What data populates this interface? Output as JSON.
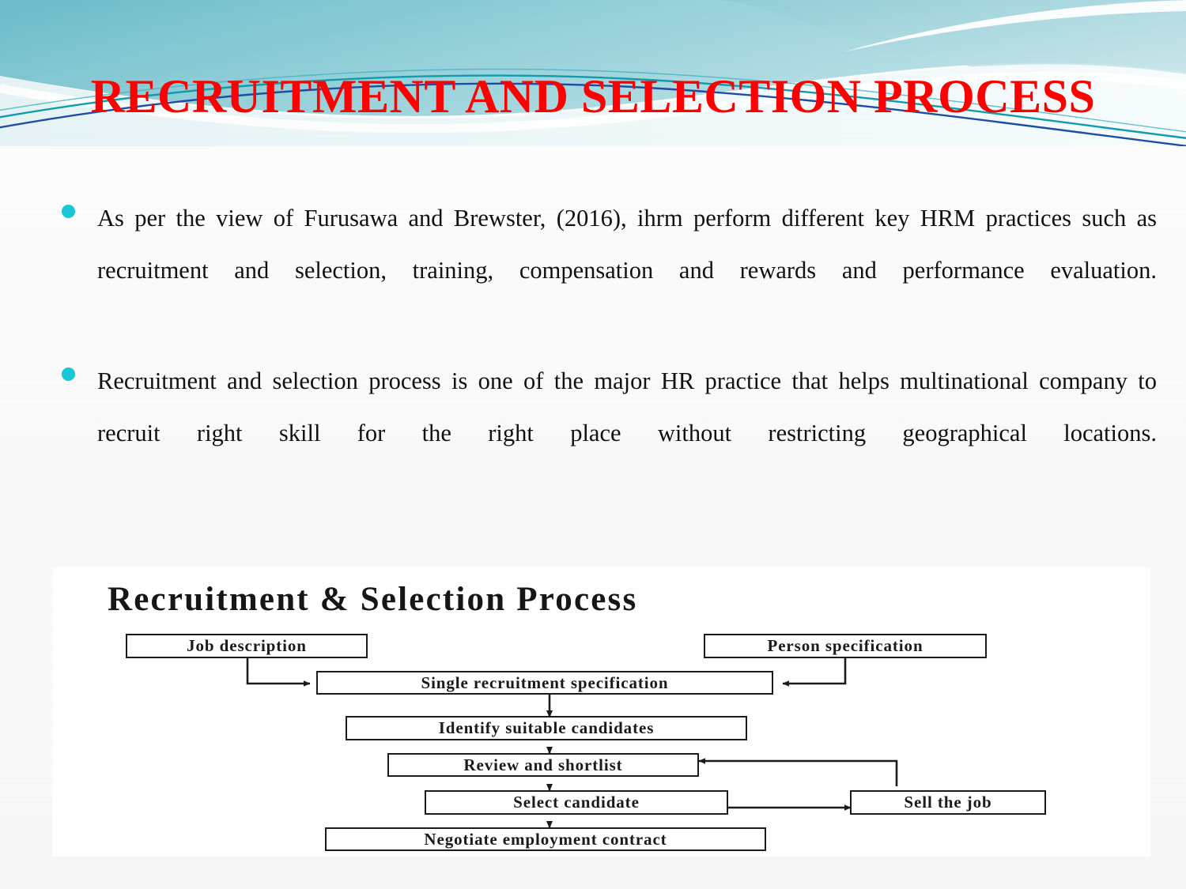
{
  "slide": {
    "title": "RECRUITMENT AND SELECTION PROCESS",
    "title_color": "#ff0000",
    "background_color": "#fbfbfb",
    "accent_color": "#17c7d6"
  },
  "header_decoration": {
    "band_color_top": "#78c3ce",
    "band_color_mid": "#a8d8de",
    "band_color_light": "#cfe8ec",
    "line_color_teal": "#0d9aa8",
    "line_color_blue": "#1f4fa8"
  },
  "bullets": [
    {
      "marker": "round-bullet",
      "text": "As per the view of Furusawa and Brewster, (2016), ihrm perform different key HRM practices such as recruitment and selection, training, compensation and rewards and performance evaluation."
    },
    {
      "marker": "round-bullet",
      "text": "Recruitment and selection process is one of the major HR practice that helps multinational company to recruit right skill for the right place without restricting geographical locations."
    }
  ],
  "diagram": {
    "title": "Recruitment & Selection Process",
    "boxes": [
      {
        "id": "job-description",
        "label": "Job description"
      },
      {
        "id": "person-specification",
        "label": "Person specification"
      },
      {
        "id": "single-recruitment-specification",
        "label": "Single recruitment specification"
      },
      {
        "id": "identify-suitable-candidates",
        "label": "Identify suitable candidates"
      },
      {
        "id": "review-and-shortlist",
        "label": "Review and shortlist"
      },
      {
        "id": "select-candidate",
        "label": "Select candidate"
      },
      {
        "id": "sell-the-job",
        "label": "Sell the job"
      },
      {
        "id": "negotiate-employment-contract",
        "label": "Negotiate employment contract"
      }
    ],
    "connections": [
      {
        "from": "job-description",
        "to": "single-recruitment-specification",
        "style": "elbow-arrow"
      },
      {
        "from": "person-specification",
        "to": "single-recruitment-specification",
        "style": "elbow-arrow"
      },
      {
        "from": "single-recruitment-specification",
        "to": "identify-suitable-candidates",
        "style": "straight-arrow"
      },
      {
        "from": "identify-suitable-candidates",
        "to": "review-and-shortlist",
        "style": "straight-arrow"
      },
      {
        "from": "review-and-shortlist",
        "to": "select-candidate",
        "style": "straight-arrow"
      },
      {
        "from": "sell-the-job",
        "to": "review-and-shortlist",
        "style": "elbow-arrow"
      },
      {
        "from": "select-candidate",
        "to": "sell-the-job",
        "style": "double-arrow"
      },
      {
        "from": "select-candidate",
        "to": "negotiate-employment-contract",
        "style": "straight-arrow"
      }
    ]
  }
}
